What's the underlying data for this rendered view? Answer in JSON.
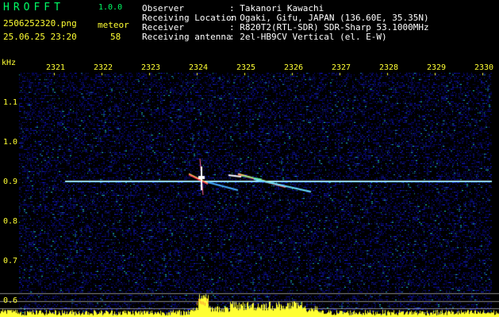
{
  "app": {
    "name": "HROFFT",
    "version": "1.0.0"
  },
  "file": {
    "name": "2506252320.png",
    "datetime": "25.06.25 23:20"
  },
  "detection": {
    "label": "meteor",
    "count": "58"
  },
  "info": [
    {
      "key": "Observer",
      "value": ": Takanori Kawachi"
    },
    {
      "key": "Receiving Location",
      "value": ": Ogaki, Gifu, JAPAN (136.60E, 35.35N)"
    },
    {
      "key": "Receiver",
      "value": ": R820T2(RTL-SDR) SDR-Sharp 53.1000MHz"
    },
    {
      "key": "Receiving antenna",
      "value": ": 2el-HB9CV Vertical (el. E-W)"
    }
  ],
  "axis": {
    "y_unit": "kHz",
    "y_ticks": [
      "1.1",
      "1.0",
      "0.9",
      "0.8",
      "0.7",
      "0.6"
    ],
    "x_ticks": [
      "2321",
      "2322",
      "2323",
      "2324",
      "2325",
      "2326",
      "2327",
      "2328",
      "2329",
      "2330"
    ]
  },
  "colors": {
    "background": "#000000",
    "label": "#ffff33",
    "title": "#00ff66",
    "carrier": "#66ccff"
  }
}
